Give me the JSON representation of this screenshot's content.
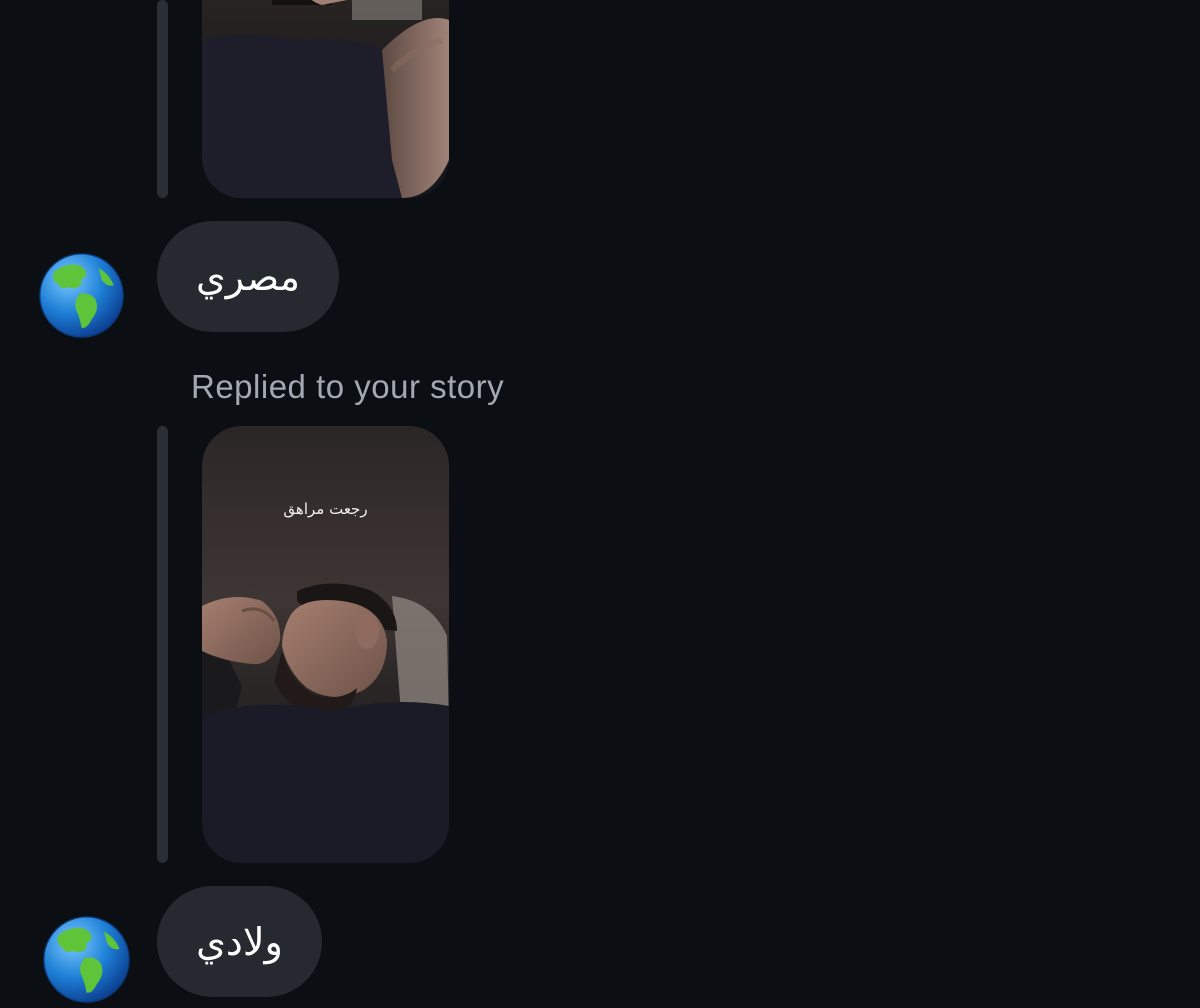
{
  "conversation": {
    "messages": [
      {
        "type": "story_reply_preview",
        "story_text": ""
      },
      {
        "type": "text",
        "text": "مصري"
      },
      {
        "type": "story_reply",
        "label": "Replied to your story",
        "story_text": "رجعت مراهق"
      },
      {
        "type": "text",
        "text": "ولادي"
      }
    ],
    "avatar_icon": "globe-americas-icon"
  },
  "colors": {
    "background": "#0b0f14",
    "bubble": "#262a30",
    "reply_bar": "#2a2e35",
    "label": "#a3a9b2",
    "text": "#ffffff"
  }
}
